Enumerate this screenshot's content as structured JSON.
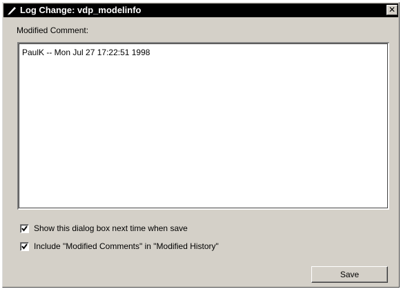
{
  "window": {
    "title": "Log Change: vdp_modelinfo",
    "close_glyph": "✕",
    "icon": "matlab-pen-icon"
  },
  "comment": {
    "label": "Modified Comment:",
    "value": "PaulK -- Mon Jul 27 17:22:51 1998"
  },
  "options": [
    {
      "label": "Show this dialog box next time when save",
      "checked": true
    },
    {
      "label": "Include \"Modified Comments\" in \"Modified History\"",
      "checked": true
    }
  ],
  "actions": {
    "save_label": "Save"
  },
  "colors": {
    "dialog_bg": "#d4d0c8",
    "titlebar_bg": "#000000",
    "titlebar_text": "#ffffff"
  }
}
